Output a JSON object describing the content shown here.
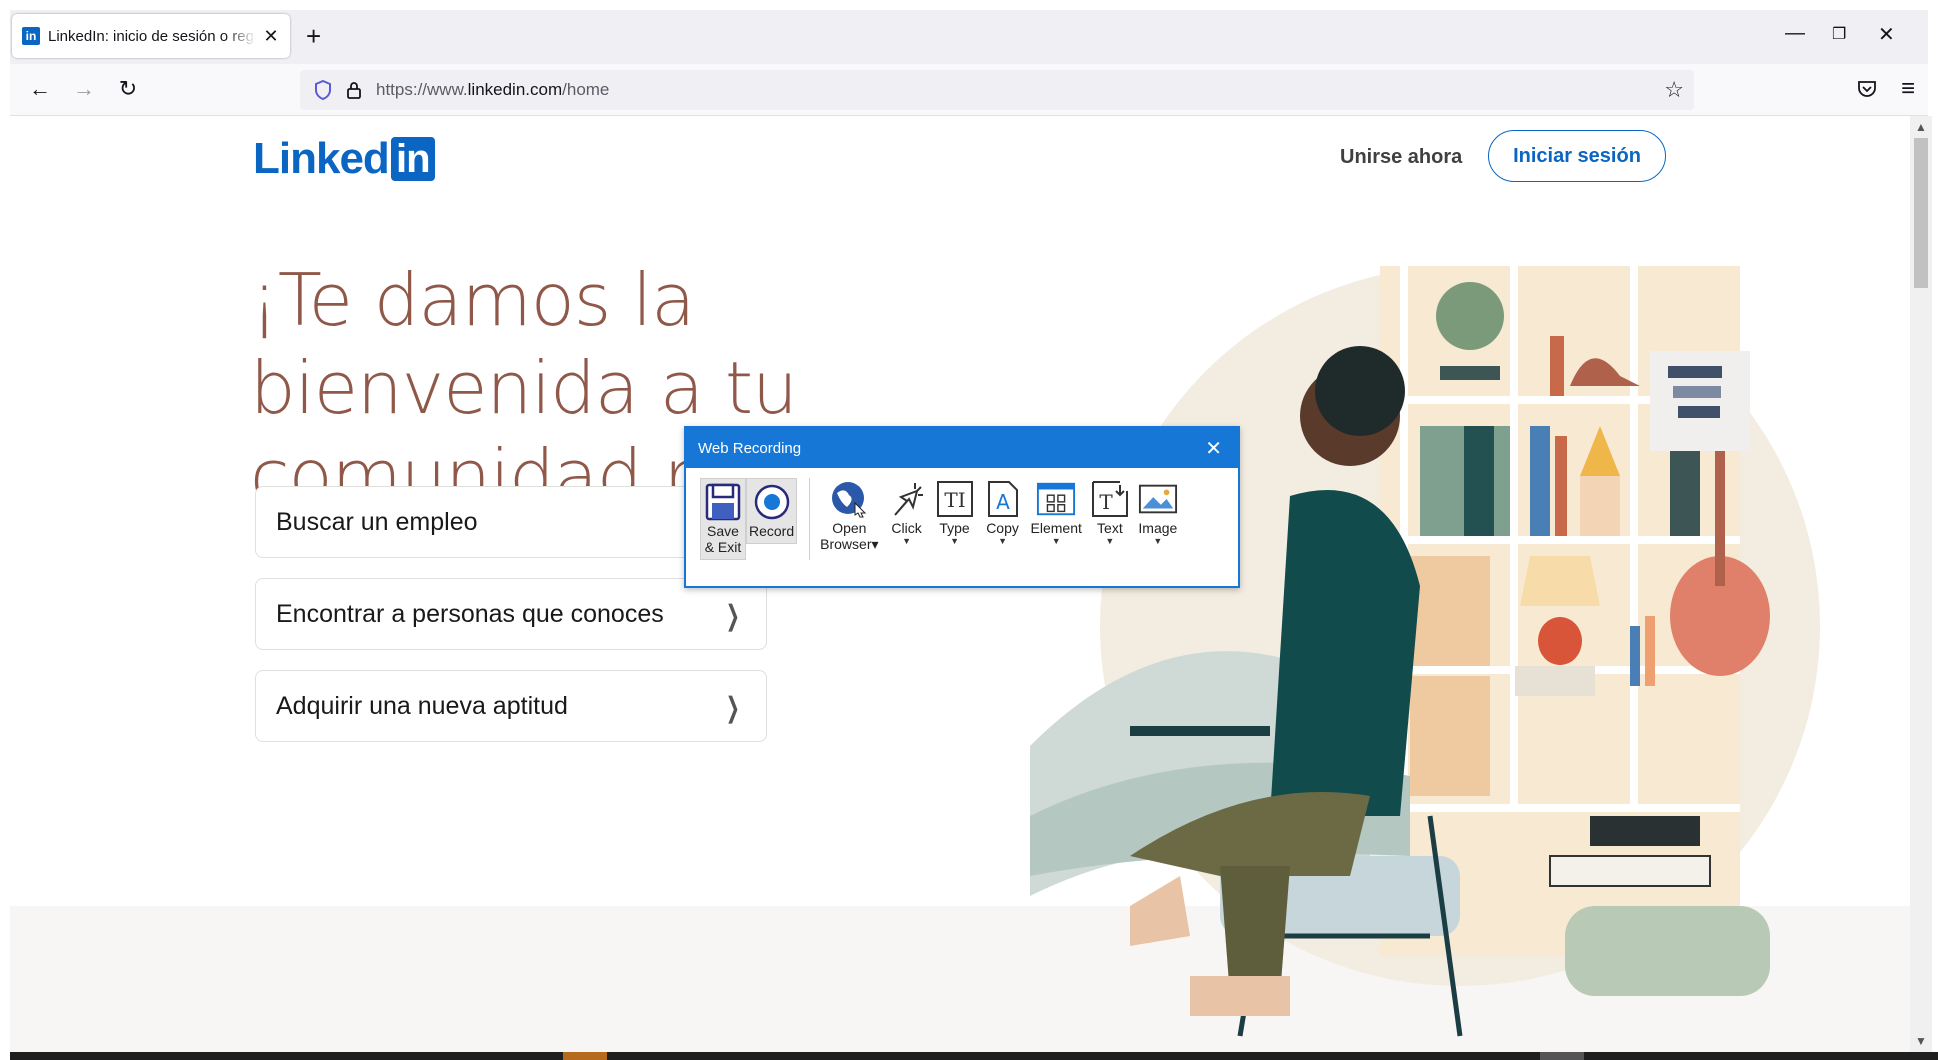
{
  "browser": {
    "tab_title": "LinkedIn: inicio de sesión o registro",
    "tab_favicon": "in",
    "new_tab_symbol": "+",
    "url_prefix": "https://www.",
    "url_domain": "linkedin.com",
    "url_path": "/home"
  },
  "page": {
    "logo_text": "Linked",
    "logo_badge": "in",
    "join_label": "Unirse ahora",
    "signin_label": "Iniciar sesión",
    "headline": "¡Te damos la bienvenida a tu comunidad profesional!",
    "options": [
      {
        "label": "Buscar un empleo"
      },
      {
        "label": "Encontrar a personas que conoces"
      },
      {
        "label": "Adquirir una nueva aptitud"
      }
    ]
  },
  "web_recording": {
    "title": "Web Recording",
    "tools": [
      {
        "label_line1": "Save",
        "label_line2": "& Exit",
        "icon": "floppy-disk-icon"
      },
      {
        "label_line1": "Record",
        "icon": "record-icon"
      },
      {
        "label_line1": "Open",
        "label_line2": "Browser",
        "icon": "globe-cursor-icon"
      },
      {
        "label_line1": "Click",
        "icon": "click-icon"
      },
      {
        "label_line1": "Type",
        "icon": "type-icon"
      },
      {
        "label_line1": "Copy",
        "icon": "copy-icon"
      },
      {
        "label_line1": "Element",
        "icon": "element-icon"
      },
      {
        "label_line1": "Text",
        "icon": "text-icon"
      },
      {
        "label_line1": "Image",
        "icon": "image-icon"
      }
    ]
  },
  "colors": {
    "brand": "#0a66c2",
    "headline": "#8f5849",
    "dialog_accent": "#1677d6"
  }
}
